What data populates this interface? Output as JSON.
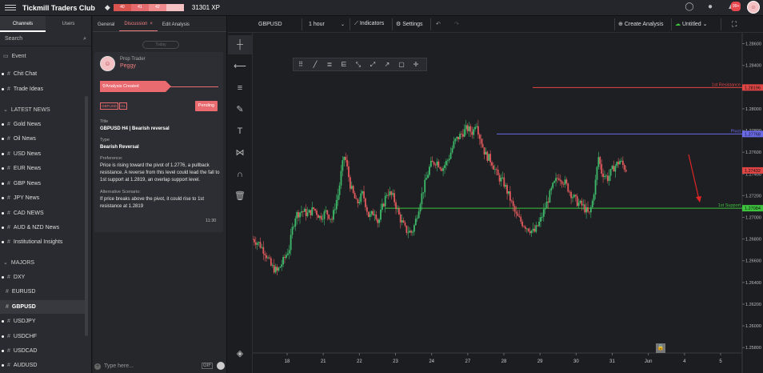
{
  "topbar": {
    "brand": "Tickmill Traders Club",
    "xp_segments": [
      {
        "label": "40",
        "color": "#d9534f"
      },
      {
        "label": "41",
        "color": "#e56b6f"
      },
      {
        "label": "42",
        "color": "#f08a8d"
      },
      {
        "label": "",
        "color": "#f5c2c4"
      }
    ],
    "xp_text": "31301 XP",
    "notif_badge": "99+"
  },
  "sidebar": {
    "tabs": [
      {
        "label": "Channels"
      },
      {
        "label": "Users"
      }
    ],
    "search_placeholder": "Search",
    "event_label": "Event",
    "categories": {
      "latest_news": "LATEST NEWS",
      "majors": "MAJORS"
    },
    "items": [
      {
        "label": "Chit Chat"
      },
      {
        "label": "Trade Ideas"
      },
      {
        "label": "Gold News"
      },
      {
        "label": "Oil News"
      },
      {
        "label": "USD News"
      },
      {
        "label": "EUR News"
      },
      {
        "label": "GBP News"
      },
      {
        "label": "JPY News"
      },
      {
        "label": "CAD NEWS"
      },
      {
        "label": "AUD & NZD News"
      },
      {
        "label": "Institutional Insights"
      },
      {
        "label": "DXY"
      },
      {
        "label": "EURUSD"
      },
      {
        "label": "GBPUSD"
      },
      {
        "label": "USDJPY"
      },
      {
        "label": "USDCHF"
      },
      {
        "label": "USDCAD"
      },
      {
        "label": "AUDUSD"
      }
    ]
  },
  "panel": {
    "tabs": [
      {
        "label": "General"
      },
      {
        "label": "Discussion"
      },
      {
        "label": "Edit Analysis"
      }
    ],
    "date_chip": "Today",
    "author_role": "Prop Trader",
    "author_name": "Peggy",
    "analysis_created": "Analysis Created",
    "tags": [
      "GBPUSD",
      "H1"
    ],
    "status": "Pending",
    "title_label": "Title",
    "title_value": "GBPUSD H4 | Bearish reversal",
    "type_label": "Type",
    "type_value": "Bearish Reversal",
    "pref_label": "Preference:",
    "pref_text": "Price is rising toward the pivot of 1.2776, a pullback resistance. A reverse from this level could lead the fall to 1st  support at 1.2819, an overlap support level.",
    "alt_label": "Alternative Scenario:",
    "alt_text": "If price breaks above the pivot, it could rise to 1st resistance at 1.2819",
    "time": "11:30",
    "input_placeholder": "Type here...",
    "gif_label": "GIF"
  },
  "chartbar": {
    "symbol": "GBPUSD",
    "timeframe": "1 hour",
    "indicators": "Indicators",
    "settings": "Settings",
    "create_analysis": "Create Analysis",
    "untitled": "Untitled"
  },
  "chart_data": {
    "type": "candlestick",
    "x_ticks": [
      "18",
      "21",
      "22",
      "23",
      "24",
      "27",
      "28",
      "29",
      "30",
      "31",
      "Jun",
      "4",
      "5"
    ],
    "y_ticks": [
      "1.28600",
      "1.28400",
      "1.28200",
      "1.28000",
      "1.27800",
      "1.27600",
      "1.27400",
      "1.27200",
      "1.27000",
      "1.26800",
      "1.26600",
      "1.26400",
      "1.26200",
      "1.26000",
      "1.25800"
    ],
    "ylim": [
      1.2575,
      1.287
    ],
    "lines": [
      {
        "label": "1st Resistance",
        "value": 1.28196,
        "value_label": "1.28196",
        "color": "#e04545"
      },
      {
        "label": "Pivot",
        "value": 1.27768,
        "value_label": "1.27768",
        "color": "#6a6ae8"
      },
      {
        "label": "1st Support",
        "value": 1.27084,
        "value_label": "1.27084",
        "color": "#3cc23c"
      }
    ],
    "current_price": "1.27432",
    "current_value": 1.27432,
    "close_path": [
      [
        0,
        1.268
      ],
      [
        2,
        1.2676
      ],
      [
        4,
        1.2668
      ],
      [
        6,
        1.2655
      ],
      [
        8,
        1.265
      ],
      [
        10,
        1.266
      ],
      [
        12,
        1.2672
      ],
      [
        13,
        1.269
      ],
      [
        14,
        1.2702
      ],
      [
        16,
        1.2706
      ],
      [
        18,
        1.2703
      ],
      [
        20,
        1.2708
      ],
      [
        22,
        1.27
      ],
      [
        24,
        1.2705
      ],
      [
        26,
        1.2698
      ],
      [
        27,
        1.2712
      ],
      [
        28,
        1.2722
      ],
      [
        29,
        1.2743
      ],
      [
        30,
        1.2758
      ],
      [
        32,
        1.2728
      ],
      [
        34,
        1.2712
      ],
      [
        36,
        1.2722
      ],
      [
        38,
        1.27
      ],
      [
        40,
        1.2706
      ],
      [
        41,
        1.2694
      ],
      [
        42,
        1.2706
      ],
      [
        44,
        1.2724
      ],
      [
        46,
        1.2718
      ],
      [
        48,
        1.27
      ],
      [
        50,
        1.2688
      ],
      [
        52,
        1.2686
      ],
      [
        53,
        1.2694
      ],
      [
        55,
        1.2718
      ],
      [
        57,
        1.2738
      ],
      [
        58,
        1.2748
      ],
      [
        60,
        1.2752
      ],
      [
        62,
        1.2745
      ],
      [
        64,
        1.2754
      ],
      [
        66,
        1.277
      ],
      [
        68,
        1.2776
      ],
      [
        70,
        1.2782
      ],
      [
        72,
        1.2778
      ],
      [
        73,
        1.279
      ],
      [
        74,
        1.2776
      ],
      [
        76,
        1.2758
      ],
      [
        78,
        1.2752
      ],
      [
        80,
        1.2738
      ],
      [
        82,
        1.2732
      ],
      [
        84,
        1.2718
      ],
      [
        86,
        1.2702
      ],
      [
        88,
        1.2695
      ],
      [
        90,
        1.269
      ],
      [
        92,
        1.2686
      ],
      [
        94,
        1.2697
      ],
      [
        96,
        1.2712
      ],
      [
        98,
        1.2728
      ],
      [
        100,
        1.2738
      ],
      [
        102,
        1.2732
      ],
      [
        104,
        1.2722
      ],
      [
        106,
        1.2714
      ],
      [
        108,
        1.271
      ],
      [
        110,
        1.2702
      ],
      [
        111,
        1.2714
      ],
      [
        112,
        1.2732
      ],
      [
        113,
        1.2756
      ],
      [
        114,
        1.2742
      ],
      [
        116,
        1.2736
      ],
      [
        118,
        1.2746
      ],
      [
        120,
        1.2752
      ],
      [
        121,
        1.2748
      ],
      [
        122,
        1.2744
      ]
    ],
    "x_max": 160
  }
}
